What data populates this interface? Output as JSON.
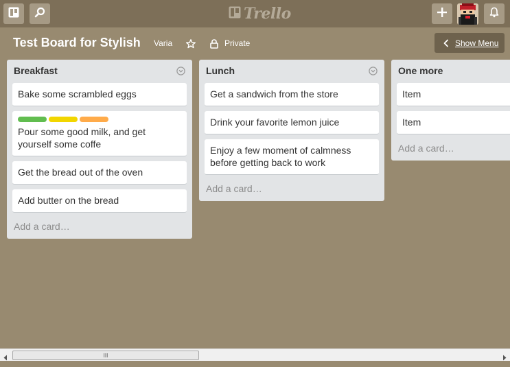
{
  "header": {
    "boards_icon": "boards-icon",
    "search_icon": "search-icon",
    "logo_text": "Trello",
    "add_icon": "plus-icon",
    "notifications_icon": "bell-icon",
    "colors": {
      "header_bg": "#7d6f58",
      "button_bg": "#a69a85",
      "board_bg": "#988a70"
    }
  },
  "board": {
    "title": "Test Board for Stylish",
    "organization": "Varia",
    "star_icon": "star-icon",
    "privacy_icon": "lock-icon",
    "privacy": "Private",
    "show_menu_label": "Show Menu"
  },
  "lists": [
    {
      "title": "Breakfast",
      "cards": [
        {
          "text": "Bake some scrambled eggs",
          "labels": []
        },
        {
          "text": "Pour some good milk, and get yourself some coffe",
          "labels": [
            "#61bd4f",
            "#f2d600",
            "#ffab4a"
          ]
        },
        {
          "text": "Get the bread out of the oven",
          "labels": []
        },
        {
          "text": "Add butter on the bread",
          "labels": []
        }
      ],
      "add_card": "Add a card…"
    },
    {
      "title": "Lunch",
      "cards": [
        {
          "text": "Get a sandwich from the store",
          "labels": []
        },
        {
          "text": "Drink your favorite lemon juice",
          "labels": []
        },
        {
          "text": "Enjoy a few moment of calmness before getting back to work",
          "labels": []
        }
      ],
      "add_card": "Add a card…"
    },
    {
      "title": "One more",
      "cards": [
        {
          "text": "Item",
          "labels": []
        },
        {
          "text": "Item",
          "labels": []
        }
      ],
      "add_card": "Add a card…"
    }
  ],
  "scrollbar": {
    "thumb_grip": "III"
  }
}
